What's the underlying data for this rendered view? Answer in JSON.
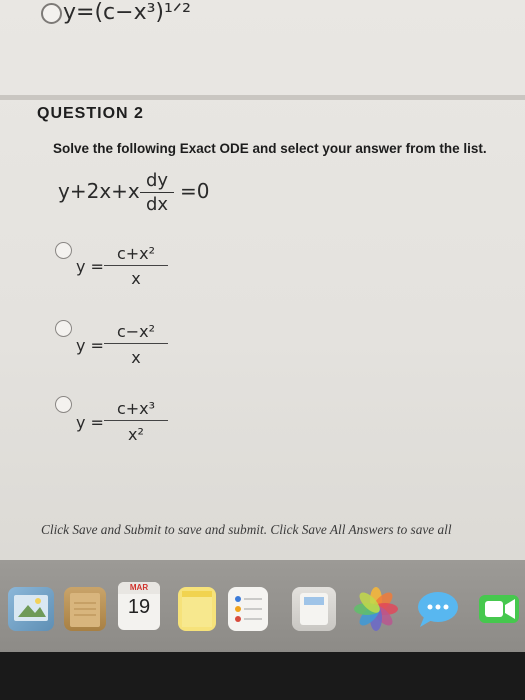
{
  "previous_option": {
    "radio_selected": false,
    "expression": "y=(c−x³)¹ᐟ²"
  },
  "question": {
    "title": "QUESTION 2",
    "prompt": "Solve the following Exact ODE and select your answer from the list.",
    "ode_lhs": "y+2x+x",
    "ode_num": "dy",
    "ode_den": "dx",
    "ode_rhs": "=0"
  },
  "options": [
    {
      "lhs": "y =",
      "numerator": "c+x²",
      "denominator": "x",
      "selected": false
    },
    {
      "lhs": "y =",
      "numerator": "c−x²",
      "denominator": "x",
      "selected": false
    },
    {
      "lhs": "y =",
      "numerator": "c+x³",
      "denominator": "x²",
      "selected": false
    }
  ],
  "footer_text": "Click Save and Submit to save and submit. Click Save All Answers to save all",
  "dock": {
    "items": [
      {
        "name": "preview-app-icon"
      },
      {
        "name": "notes-app-icon"
      },
      {
        "name": "calendar-app-icon",
        "month": "MAR",
        "day": "19"
      },
      {
        "name": "stickies-app-icon"
      },
      {
        "name": "reminders-app-icon"
      },
      {
        "name": "calculator-app-icon"
      },
      {
        "name": "photos-app-icon"
      },
      {
        "name": "messages-app-icon"
      },
      {
        "name": "facetime-app-icon"
      }
    ]
  }
}
